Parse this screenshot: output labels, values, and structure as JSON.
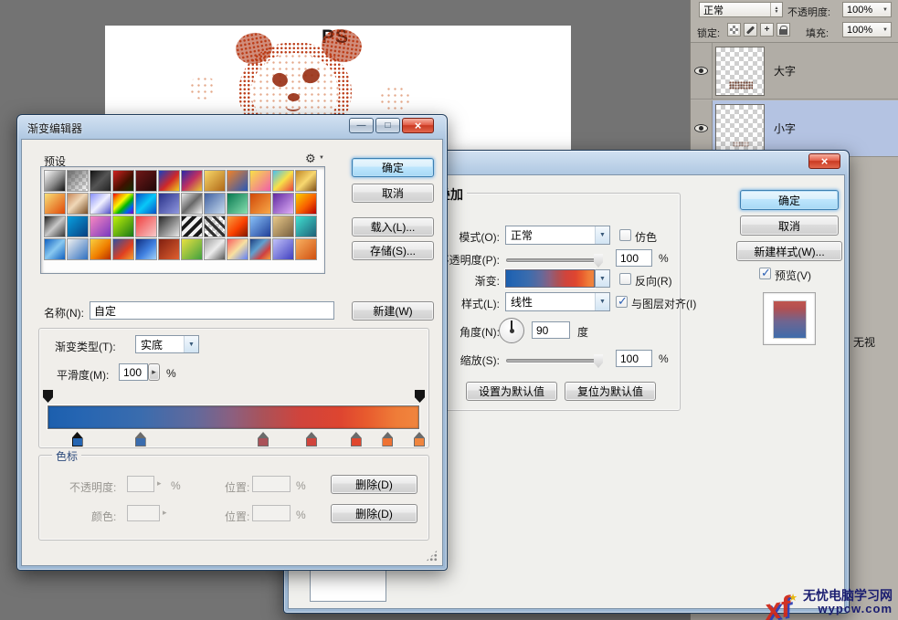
{
  "canvas": {
    "title": "PS"
  },
  "shared": {
    "percent": "%",
    "gradient_css": "linear-gradient(90deg,#1c5fae 0%,#2565b2 8%,#3a6cae 25%,#63699b 40%,#8d5f7e 50%,#aa5259 58%,#d0443c 68%,#de4530 79%,#e85b2e 86%,#ef7c38 94%,#f0853e 100%)",
    "preview_css": "linear-gradient(0deg,#3f6cab 0%,#6f6590 45%,#b15052 80%,#c0564e 100%)"
  },
  "icons": {
    "close": "×",
    "minimize": "—",
    "maximize": "□",
    "dropdown": "▼",
    "spinner_up": "▲",
    "spinner_down": "▼",
    "side_arrow": "▸",
    "gear": "⚙",
    "star": "★"
  },
  "layers_panel": {
    "blend_mode": "正常",
    "opacity_label": "不透明度:",
    "opacity_value": "100%",
    "lock_label": "锁定:",
    "fill_label": "填充:",
    "fill_value": "100%",
    "layers": [
      {
        "name": "大字"
      },
      {
        "name": "小字"
      }
    ],
    "fragment_text": "无视"
  },
  "gradient_editor": {
    "title": "渐变编辑器",
    "presets_label": "预设",
    "buttons": {
      "ok": "确定",
      "cancel": "取消",
      "load": "载入(L)...",
      "save": "存储(S)...",
      "new": "新建(W)"
    },
    "name_label": "名称(N):",
    "name_value": "自定",
    "type_label": "渐变类型(T):",
    "type_value": "实底",
    "smoothness_label": "平滑度(M):",
    "smoothness_value": "100",
    "stops_group_label": "色标",
    "stop_opacity_label": "不透明度:",
    "stop_color_label": "颜色:",
    "location_label": "位置:",
    "delete_label": "删除(D)",
    "opacity_stops": [
      {
        "pos": 0
      },
      {
        "pos": 100
      }
    ],
    "color_stops": [
      {
        "pos": 8,
        "color": "#2565b2",
        "selected": true
      },
      {
        "pos": 25,
        "color": "#3a6cae"
      },
      {
        "pos": 58,
        "color": "#aa5259"
      },
      {
        "pos": 71,
        "color": "#d0443c"
      },
      {
        "pos": 83,
        "color": "#e0472e"
      },
      {
        "pos": 91.5,
        "color": "#ee7233"
      },
      {
        "pos": 100,
        "color": "#f0853e"
      }
    ],
    "presets": [
      "linear-gradient(135deg,#fdfdfd,#8a8a8a 55%,#111111)",
      "linear-gradient(135deg,#6a6a6a,rgba(120,120,120,0))",
      "linear-gradient(135deg,#111111,#555555 50%,#222222)",
      "linear-gradient(135deg,#d02020,#401000 60%,#103000)",
      "linear-gradient(135deg,#701818,#200808)",
      "linear-gradient(135deg,#1840c0,#d02828 55%,#f0d020)",
      "linear-gradient(135deg,#2828a8,#c03060 50%,#e8c830)",
      "linear-gradient(135deg,#f8d868,#b06818)",
      "linear-gradient(135deg,#f08228,#2858b8)",
      "linear-gradient(135deg,#f8e048,#f060a8)",
      "linear-gradient(135deg,#48c0f0,#f8e048 50%,#e84040)",
      "linear-gradient(135deg,#c08828,#f8d870 50%,#805018)",
      "linear-gradient(135deg,#f8e078,#e04808)",
      "linear-gradient(135deg,#c88858,#f0d8b8 45%,#7a5028)",
      "linear-gradient(135deg,#8890f8,#f0f0ff 50%,#5050c8)",
      "linear-gradient(135deg,#f00000,#f89000 20%,#f8f800 40%,#00b800 60%,#0060f8 80%,#8000c0)",
      "linear-gradient(135deg,#0850c8,#08c8f8 50%,#0850c8)",
      "linear-gradient(135deg,#283088,#9098e0)",
      "linear-gradient(135deg,#e8e8e8,#686868 50%,#f8f8f8)",
      "linear-gradient(135deg,#4060a0,#c8dcf0)",
      "linear-gradient(135deg,#087850,#88e0b0)",
      "linear-gradient(135deg,#d04808,#f8a848)",
      "linear-gradient(135deg,#6028a0,#e0b0f8)",
      "linear-gradient(135deg,#f8d000,#f86000 55%,#b80000)",
      "linear-gradient(135deg,#202020,#c8c8c8 50%,#383838)",
      "linear-gradient(135deg,#08a0e0,#083f80)",
      "linear-gradient(135deg,#f888c0,#7838c0)",
      "linear-gradient(135deg,#c0f008,#187818)",
      "linear-gradient(135deg,#f04040,#f8c8c8)",
      "linear-gradient(135deg,#282828,#e8e8e8)",
      "repeating-linear-gradient(135deg,#181818 0 4px,#f0f0f0 4px 8px)",
      "repeating-linear-gradient(45deg,#303030 0 3px,rgba(255,255,255,0) 3px 7px)",
      "linear-gradient(135deg,#f8a040,#f84000 55%,#801800)",
      "linear-gradient(135deg,#88c0f8,#203f98)",
      "linear-gradient(135deg,#e8c888,#786040)",
      "linear-gradient(135deg,#40e0d0,#1f6078)",
      "linear-gradient(135deg,#1060c0,#88c8f0 50%,#1060c0)",
      "linear-gradient(135deg,#f0f0f0,#3070c0)",
      "linear-gradient(135deg,#f8cf40,#f08000 55%,#b83000)",
      "linear-gradient(135deg,#2f50a0,#e04020 60%,#f0a030)",
      "linear-gradient(135deg,#102f80,#4080e0 55%,#a0d0f8)",
      "linear-gradient(135deg,#801f10,#e06030)",
      "linear-gradient(135deg,#e8e040,#40a040)",
      "linear-gradient(135deg,#a0a0a0,#ececec 50%,#585858)",
      "linear-gradient(135deg,#f86060,#f8e0a0 50%,#6080f8)",
      "linear-gradient(135deg,#1f4080,#60a0d0 40%,#d04040 70%,#f0a040)",
      "linear-gradient(135deg,#c0c0f8,#4040c0)",
      "linear-gradient(135deg,#f8b060,#d05010)"
    ]
  },
  "layer_style": {
    "section_header": "渐变叠加",
    "mode_label": "模式(O):",
    "mode_value": "正常",
    "dither_label": "仿色",
    "opacity_label": "不透明度(P):",
    "opacity_value": "100",
    "gradient_label": "渐变:",
    "reverse_label": "反向(R)",
    "style_label": "样式(L):",
    "style_value": "线性",
    "align_label": "与图层对齐(I)",
    "angle_label": "角度(N):",
    "angle_value": "90",
    "degree_label": "度",
    "scale_label": "缩放(S):",
    "scale_value": "100",
    "set_default_label": "设置为默认值",
    "reset_default_label": "复位为默认值",
    "buttons": {
      "ok": "确定",
      "cancel": "取消",
      "new_style": "新建样式(W)..."
    },
    "preview_label": "预览(V)"
  },
  "watermark": {
    "line1": "无忧电脑学习网",
    "line2": "wypcw.com",
    "logo_text": "xf"
  }
}
